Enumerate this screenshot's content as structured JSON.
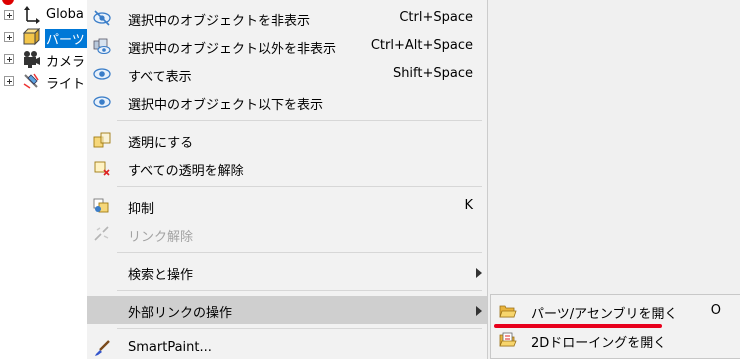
{
  "tree": {
    "items": [
      {
        "label": "Globa",
        "icon": "axes-icon"
      },
      {
        "label": "パーツ",
        "icon": "part-cube-icon",
        "selected": true
      },
      {
        "label": "カメラ",
        "icon": "camera-icon"
      },
      {
        "label": "ライト",
        "icon": "light-icon"
      }
    ]
  },
  "menu": {
    "items": [
      {
        "label": "選択中のオブジェクトを非表示",
        "shortcut": "Ctrl+Space",
        "icon": "hide-eye-icon"
      },
      {
        "label": "選択中のオブジェクト以外を非表示",
        "shortcut": "Ctrl+Alt+Space",
        "icon": "hide-others-icon"
      },
      {
        "label": "すべて表示",
        "shortcut": "Shift+Space",
        "icon": "eye-icon"
      },
      {
        "label": "選択中のオブジェクト以下を表示",
        "shortcut": "",
        "icon": "eye-icon"
      },
      {
        "label": "透明にする",
        "shortcut": "",
        "icon": "transparent-icon"
      },
      {
        "label": "すべての透明を解除",
        "shortcut": "",
        "icon": "clear-transparency-icon"
      },
      {
        "label": "抑制",
        "shortcut": "K",
        "icon": "suppress-icon"
      },
      {
        "label": "リンク解除",
        "shortcut": "",
        "icon": "unlink-icon",
        "disabled": true
      },
      {
        "label": "検索と操作",
        "shortcut": "",
        "icon": "",
        "submenu": true
      },
      {
        "label": "外部リンクの操作",
        "shortcut": "",
        "icon": "",
        "submenu": true,
        "highlighted": true
      },
      {
        "label": "SmartPaint...",
        "shortcut": "",
        "icon": "paintbrush-icon"
      }
    ]
  },
  "submenu": {
    "items": [
      {
        "label": "パーツ/アセンブリを開く",
        "shortcut": "O",
        "icon": "open-folder-icon"
      },
      {
        "label": "2Dドローイングを開く",
        "shortcut": "",
        "icon": "open-drawing-icon"
      }
    ]
  },
  "colors": {
    "menu_bg": "#f2f2f2",
    "highlight": "#cfcfcf",
    "selection": "#0078d7",
    "annotation_underline": "#e8001c"
  }
}
